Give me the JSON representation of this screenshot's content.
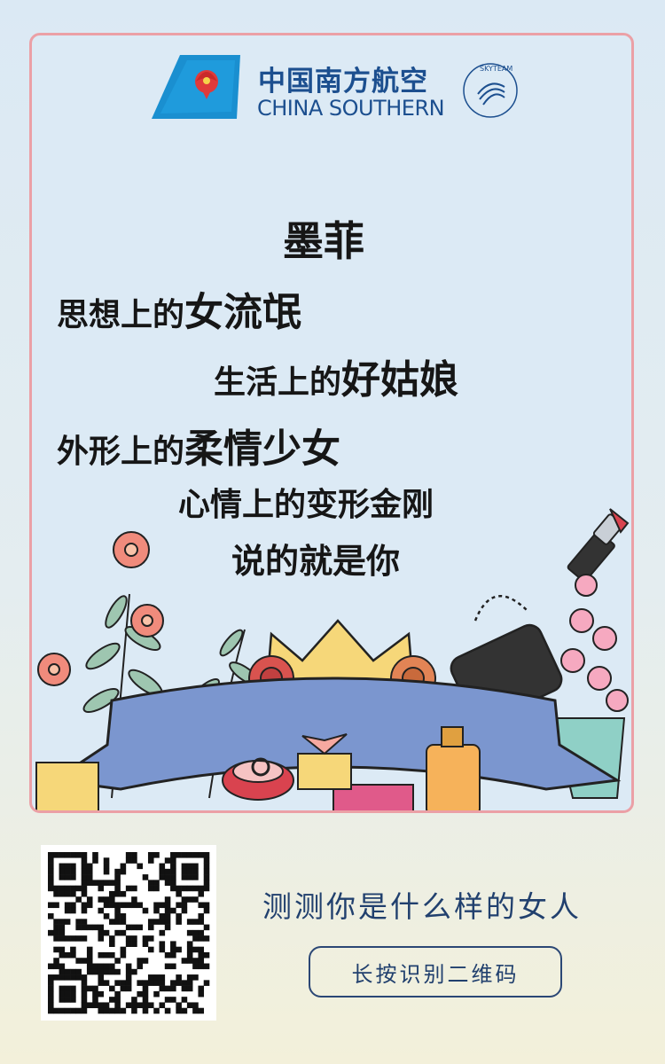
{
  "logo": {
    "name_cn": "中国南方航空",
    "name_en": "CHINA SOUTHERN",
    "alliance": "SKYTEAM"
  },
  "message": {
    "title": "墨菲",
    "lines": [
      {
        "prefix": "思想上的",
        "emphasis": "女流氓"
      },
      {
        "prefix": "生活上的",
        "emphasis": "好姑娘"
      },
      {
        "prefix": "外形上的",
        "emphasis": "柔情少女"
      },
      {
        "prefix": "心情上的",
        "emphasis": "变形金刚"
      }
    ],
    "closing": "说的就是你"
  },
  "footer": {
    "tagline": "测测你是什么样的女人",
    "button_label": "长按识别二维码"
  },
  "colors": {
    "brand_blue": "#1c4f8f",
    "card_border": "#eba0a6",
    "ribbon": "#7b96cf",
    "button_border": "#2b4775"
  },
  "icons": [
    "kapok-flower-logo-icon",
    "skyteam-logo-icon",
    "qr-code-icon",
    "lipstick-icon",
    "handbag-icon",
    "crown-icon",
    "ring-box-icon",
    "gift-box-icon",
    "perfume-icon",
    "flower-icon"
  ]
}
